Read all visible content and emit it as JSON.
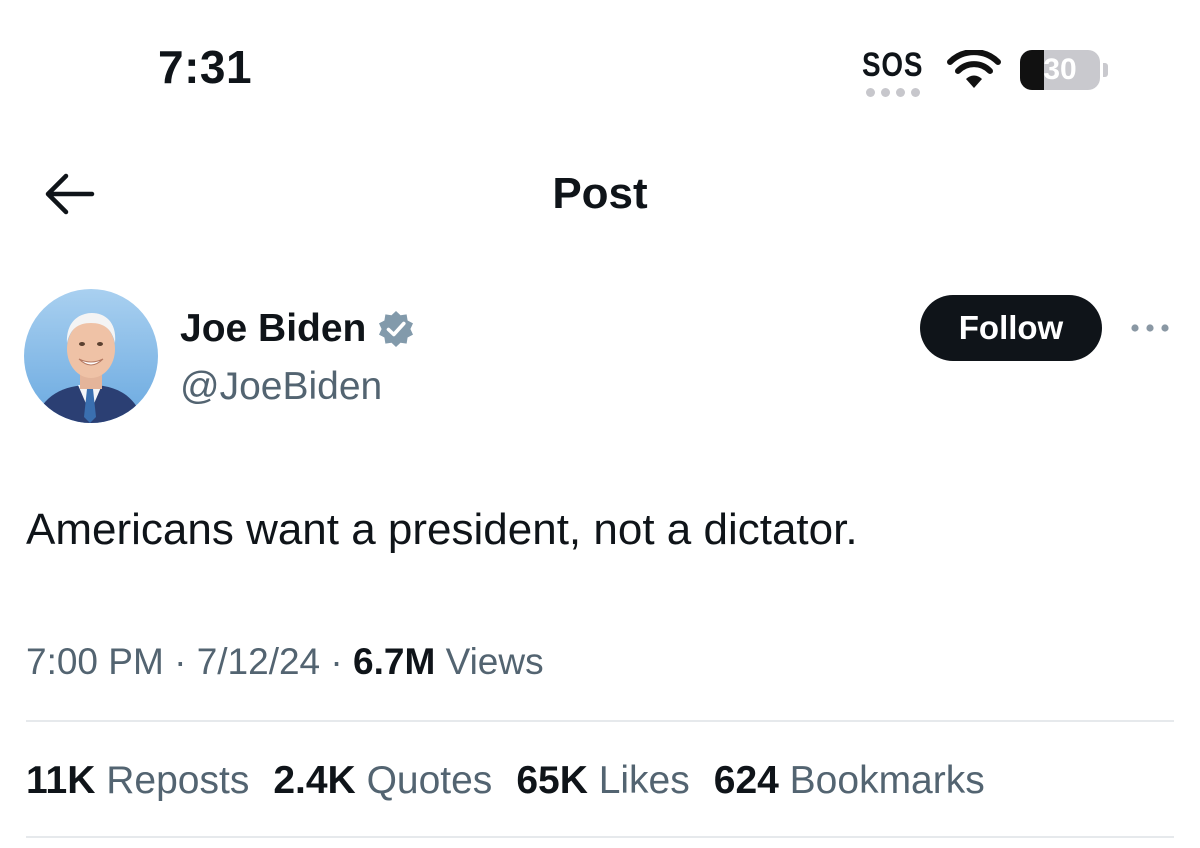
{
  "status_bar": {
    "time": "7:31",
    "sos": "SOS",
    "battery": "30",
    "battery_level": 0.3
  },
  "header": {
    "title": "Post"
  },
  "author": {
    "name": "Joe Biden",
    "handle": "@JoeBiden",
    "follow_label": "Follow"
  },
  "tweet": {
    "text": "Americans want a president, not a dictator.",
    "time": "7:00 PM",
    "date": "7/12/24",
    "sep": "·",
    "views_count": "6.7M",
    "views_label": "Views"
  },
  "stats": [
    {
      "count": "11K",
      "label": "Reposts"
    },
    {
      "count": "2.4K",
      "label": "Quotes"
    },
    {
      "count": "65K",
      "label": "Likes"
    },
    {
      "count": "624",
      "label": "Bookmarks"
    }
  ],
  "colors": {
    "text_primary": "#0f1419",
    "text_secondary": "#536471",
    "verified": "#829aab",
    "follow_bg": "#0f1419"
  },
  "icons": [
    "back-arrow-icon",
    "verified-badge-icon",
    "more-options-icon",
    "wifi-icon",
    "battery-icon"
  ]
}
